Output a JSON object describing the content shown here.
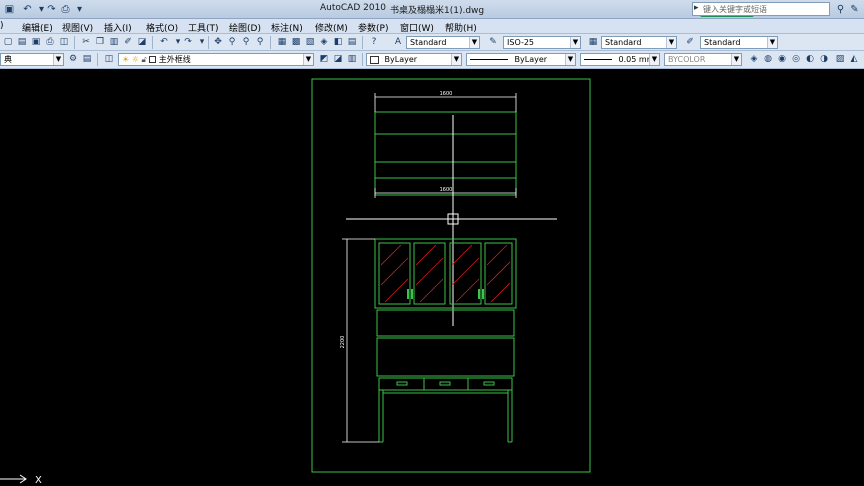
{
  "window": {
    "app_title": "AutoCAD 2010",
    "file_title": "书桌及榻榻米1(1).dwg",
    "search_placeholder": "键入关键字或短语"
  },
  "menu": {
    "items": [
      ")",
      "编辑(E)",
      "视图(V)",
      "插入(I)",
      "格式(O)",
      "工具(T)",
      "绘图(D)",
      "标注(N)",
      "修改(M)",
      "参数(P)",
      "窗口(W)",
      "帮助(H)"
    ]
  },
  "styles_toolbar": {
    "text_style": "Standard",
    "dim_style": "ISO-25",
    "table_style": "Standard",
    "multileader_style": "Standard"
  },
  "layers_toolbar": {
    "workspace": "典",
    "layer": "主外框线",
    "color": "ByLayer",
    "linetype": "ByLayer",
    "lineweight": "0.05 mm",
    "plot_style": "BYCOLOR"
  },
  "drawing": {
    "dim_top": "1600",
    "dim_mid": "1600",
    "dim_side": "2200",
    "ucs_x": "X"
  },
  "colors": {
    "title_bg": "#c7d6e9",
    "toolbar_bg": "#dce6f3",
    "canvas_bg": "#000000",
    "frame_green": "#3dc24a",
    "hatch_red": "#d02020",
    "crosshair": "#ffffff"
  }
}
